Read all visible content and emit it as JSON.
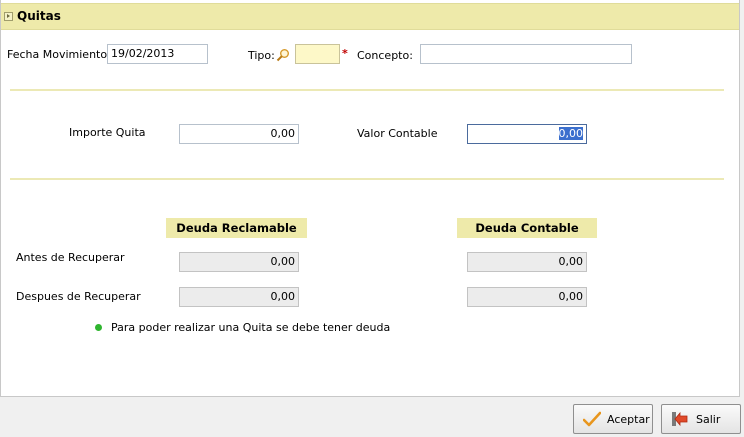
{
  "header": {
    "title": "Quitas"
  },
  "form": {
    "fecha_label": "Fecha Movimiento:",
    "fecha_value": "19/02/2013",
    "tipo_label": "Tipo:",
    "tipo_value": "",
    "required_mark": "*",
    "concepto_label": "Concepto:",
    "concepto_value": "",
    "importe_label": "Importe Quita",
    "importe_value": "0,00",
    "valor_label": "Valor Contable",
    "valor_value": "0,00"
  },
  "deuda": {
    "reclamable_header": "Deuda Reclamable",
    "contable_header": "Deuda Contable",
    "antes_label": "Antes de Recuperar",
    "despues_label": "Despues de Recuperar",
    "antes_reclamable": "0,00",
    "antes_contable": "0,00",
    "despues_reclamable": "0,00",
    "despues_contable": "0,00"
  },
  "info": {
    "message": "Para poder realizar una Quita se debe tener deuda"
  },
  "buttons": {
    "aceptar": "Aceptar",
    "salir": "Salir"
  },
  "colors": {
    "header_bg": "#eeeaaa",
    "info_dot": "#2fb52f",
    "required": "#c00000",
    "selection": "#3b6fce"
  }
}
